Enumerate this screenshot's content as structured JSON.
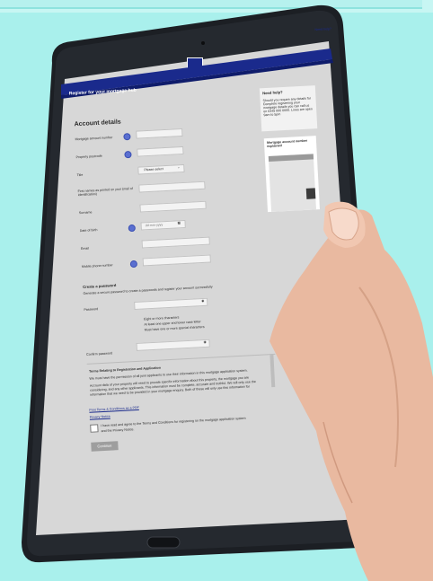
{
  "header": {
    "help_link": "Need help?",
    "banner_title": "Register for your mortgage hub"
  },
  "form": {
    "section_title": "Account details",
    "mortgage_account_number": "Mortgage account number",
    "property_postcode": "Property postcode",
    "title": "Title",
    "title_select": "Please select",
    "first_names": "First names as printed on your (mail of identification)",
    "surname": "Surname",
    "date_of_birth": "Date of birth",
    "dob_placeholder": "dd-mm-yyyy",
    "email": "Email",
    "mobile": "Mobile phone number",
    "create_password": "Create a password",
    "password_hint": "Generate a secure password to create a passwords and register your account successfully",
    "password": "Password",
    "rules": [
      "Eight or more characters",
      "At least one upper and lower case letter",
      "Must have one or more special characters"
    ],
    "confirm_password": "Confirm password",
    "terms_title": "Terms Relating to Registration and Application",
    "terms_line1": "We must have the permission of all joint applicants to use their information in this mortgage application system.",
    "terms_line2": "Account data of your property will need to provide specific information about this property, the mortgage you are",
    "terms_line3": "considering, and any other applicants. This information must be complete, accurate and truthful. We will only use the",
    "terms_line4": "information that we need to be provided in your mortgage enquiry. Both of these will only use this information for",
    "terms_link": "Print Terms & Conditions as a PDF",
    "privacy_link": "Privacy Notice",
    "agree_text": "I have read and agree to the Terms and Conditions for registering on the mortgage application system",
    "agree_text2": "and the Privacy Notice.",
    "continue_label": "Continue"
  },
  "sidebar": {
    "help_title": "Need help?",
    "help_body": "Should you require any details for Complete registering your mortgage details you can call us on 0345 000 0000. Lines are open 9am to 5pm",
    "card_title": "Mortgage account number explained"
  },
  "colors": {
    "banner": "#1a2a8c",
    "screen_bg": "#d7d7d7",
    "background": "#a9f0ec",
    "bezel": "#1c1f24"
  }
}
